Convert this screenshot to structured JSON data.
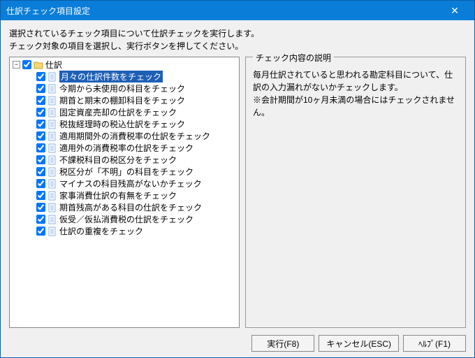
{
  "window": {
    "title": "仕訳チェック項目設定"
  },
  "description": {
    "line1": "選択されているチェック項目について仕訳チェックを実行します。",
    "line2": "チェック対象の項目を選択し、実行ボタンを押してください。"
  },
  "explanation": {
    "legend": "チェック内容の説明",
    "line1": "毎月仕訳されていると思われる勘定科目について、仕訳の入力漏れがないかチェックします。",
    "line2": "※会計期間が10ヶ月未満の場合にはチェックされません。"
  },
  "tree": {
    "root": {
      "label": "仕訳",
      "expanded": true,
      "checked": true
    },
    "items": [
      {
        "label": "月々の仕訳件数をチェック",
        "checked": true,
        "selected": true
      },
      {
        "label": "今期から未使用の科目をチェック",
        "checked": true
      },
      {
        "label": "期首と期末の棚卸科目をチェック",
        "checked": true
      },
      {
        "label": "固定資産売却の仕訳をチェック",
        "checked": true
      },
      {
        "label": "税抜経理時の税込仕訳をチェック",
        "checked": true
      },
      {
        "label": "適用期間外の消費税率の仕訳をチェック",
        "checked": true
      },
      {
        "label": "適用外の消費税率の仕訳をチェック",
        "checked": true
      },
      {
        "label": "不課税科目の税区分をチェック",
        "checked": true
      },
      {
        "label": "税区分が「不明」の科目をチェック",
        "checked": true
      },
      {
        "label": "マイナスの科目残高がないかチェック",
        "checked": true
      },
      {
        "label": "家事消費仕訳の有無をチェック",
        "checked": true
      },
      {
        "label": "期首残高がある科目の仕訳をチェック",
        "checked": true
      },
      {
        "label": "仮受／仮払消費税の仕訳をチェック",
        "checked": true
      },
      {
        "label": "仕訳の重複をチェック",
        "checked": true
      }
    ]
  },
  "buttons": {
    "run": "実行(F8)",
    "cancel": "キャンセル(ESC)",
    "help": "ﾍﾙﾌﾟ(F1)"
  }
}
